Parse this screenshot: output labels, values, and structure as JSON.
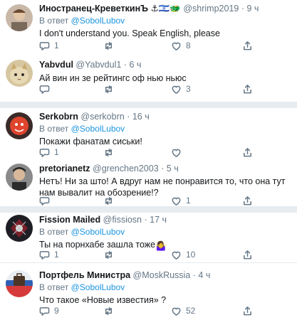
{
  "tweets": [
    {
      "name": "Иностранец-КреветкинЪ",
      "badges": "⚓🇮🇱🐲",
      "handle": "@shrimp2019",
      "dot": "·",
      "time": "9 ч",
      "reply_prefix": "В ответ",
      "reply_to": "@SobolLubov",
      "text": "I don't understand you. Speak English, please",
      "replies": "1",
      "retweets": "",
      "likes": "8",
      "avatar": "portrait-avatar"
    },
    {
      "name": "Yabvdul",
      "badges": "",
      "handle": "@Yabvdul1",
      "dot": "·",
      "time": "6 ч",
      "reply_prefix": "",
      "reply_to": "",
      "text": "Ай вин ин зе рейтингс оф нью ньюс",
      "replies": "",
      "retweets": "",
      "likes": "3",
      "avatar": "cat-avatar"
    },
    {
      "name": "Serkobrn",
      "badges": "",
      "handle": "@serkobrn",
      "dot": "·",
      "time": "16 ч",
      "reply_prefix": "В ответ",
      "reply_to": "@SobolLubov",
      "text": "Покажи фанатам сиськи!",
      "replies": "1",
      "retweets": "",
      "likes": "",
      "avatar": "red-face-avatar"
    },
    {
      "name": "pretorianetz",
      "badges": "",
      "handle": "@grenchen2003",
      "dot": "·",
      "time": "5 ч",
      "reply_prefix": "",
      "reply_to": "",
      "text": "Нетъ! Ни за што! А вдруг нам не понравится то, что она тут нам вывалит на обозрение!?",
      "replies": "",
      "retweets": "",
      "likes": "1",
      "avatar": "man-avatar"
    },
    {
      "name": "Fission Mailed",
      "badges": "",
      "handle": "@fissiosn",
      "dot": "·",
      "time": "17 ч",
      "reply_prefix": "В ответ",
      "reply_to": "@SobolLubov",
      "text": "Ты на порнхабе зашла тоже",
      "text_emoji": "🤷‍♀️",
      "replies": "1",
      "retweets": "",
      "likes": "10",
      "avatar": "dark-logo-avatar"
    },
    {
      "name": "Портфель Министра",
      "badges": "",
      "handle": "@MoskRussia",
      "dot": "·",
      "time": "4 ч",
      "reply_prefix": "В ответ",
      "reply_to": "@SobolLubov",
      "text": "Что такое «Новые известия» ?",
      "replies": "9",
      "retweets": "",
      "likes": "52",
      "avatar": "flag-avatar"
    }
  ],
  "colors": {
    "accent": "#1b95e0",
    "secondary_text": "#657786",
    "separator": "#e6ecf0"
  },
  "icons": [
    "reply-icon",
    "retweet-icon",
    "like-icon",
    "share-icon"
  ]
}
